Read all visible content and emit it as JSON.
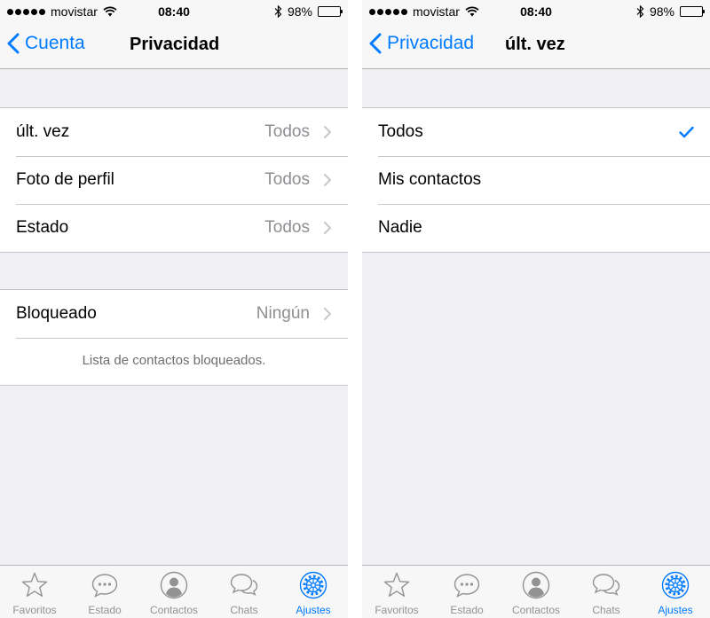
{
  "status_bar": {
    "carrier": "movistar",
    "time": "08:40",
    "battery": "98%",
    "battery_level": 0.98
  },
  "left_screen": {
    "nav": {
      "back_label": "Cuenta",
      "title": "Privacidad"
    },
    "section1": [
      {
        "label": "últ. vez",
        "value": "Todos"
      },
      {
        "label": "Foto de perfil",
        "value": "Todos"
      },
      {
        "label": "Estado",
        "value": "Todos"
      }
    ],
    "blocked": {
      "label": "Bloqueado",
      "value": "Ningún"
    },
    "blocked_footnote": "Lista de contactos bloqueados."
  },
  "right_screen": {
    "nav": {
      "back_label": "Privacidad",
      "title": "últ. vez"
    },
    "options": [
      {
        "label": "Todos",
        "selected": true
      },
      {
        "label": "Mis contactos",
        "selected": false
      },
      {
        "label": "Nadie",
        "selected": false
      }
    ]
  },
  "tab_bar": {
    "tabs": [
      {
        "label": "Favoritos",
        "icon": "star-icon"
      },
      {
        "label": "Estado",
        "icon": "speech-bubble-icon"
      },
      {
        "label": "Contactos",
        "icon": "person-icon"
      },
      {
        "label": "Chats",
        "icon": "chat-bubbles-icon"
      },
      {
        "label": "Ajustes",
        "icon": "gear-icon"
      }
    ],
    "active_tab": "Ajustes"
  },
  "colors": {
    "accent": "#007aff",
    "inactive_tab": "#929292",
    "background": "#efeff4",
    "secondary_text": "#8e8e93"
  }
}
